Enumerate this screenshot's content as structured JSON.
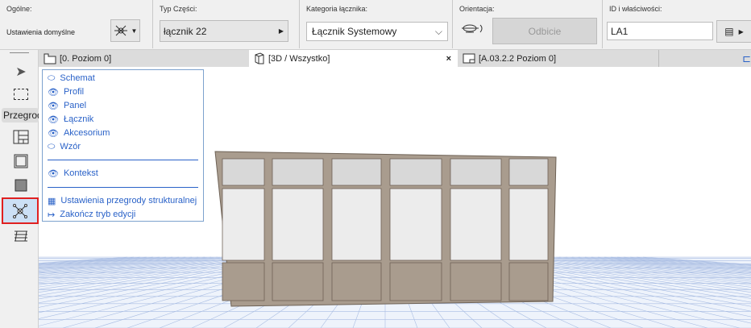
{
  "toolbar": {
    "general": {
      "label": "Ogólne:",
      "value": "Ustawienia domyślne"
    },
    "part_type": {
      "label": "Typ Części:",
      "value": "łącznik 22"
    },
    "category": {
      "label": "Kategoria łącznika:",
      "value": "Łącznik Systemowy"
    },
    "orientation": {
      "label": "Orientacja:",
      "button": "Odbicie"
    },
    "id": {
      "label": "ID i właściwości:",
      "value": "LA1"
    }
  },
  "tabs": [
    {
      "label": "[0. Poziom 0]"
    },
    {
      "label": "[3D / Wszystko]",
      "close": "×"
    },
    {
      "label": "[A.03.2.2 Poziom 0]"
    }
  ],
  "left_toolbar": {
    "group_label": "Przegrod"
  },
  "popup": {
    "items": [
      "Schemat",
      "Profil",
      "Panel",
      "Łącznik",
      "Akcesorium",
      "Wzór"
    ],
    "context": "Kontekst",
    "settings": "Ustawienia przegrody strukturalnej",
    "exit": "Zakończ tryb edycji"
  },
  "colors": {
    "accent": "#2a62c8",
    "highlight": "#e02020",
    "selected_bg": "#cce0f5"
  }
}
